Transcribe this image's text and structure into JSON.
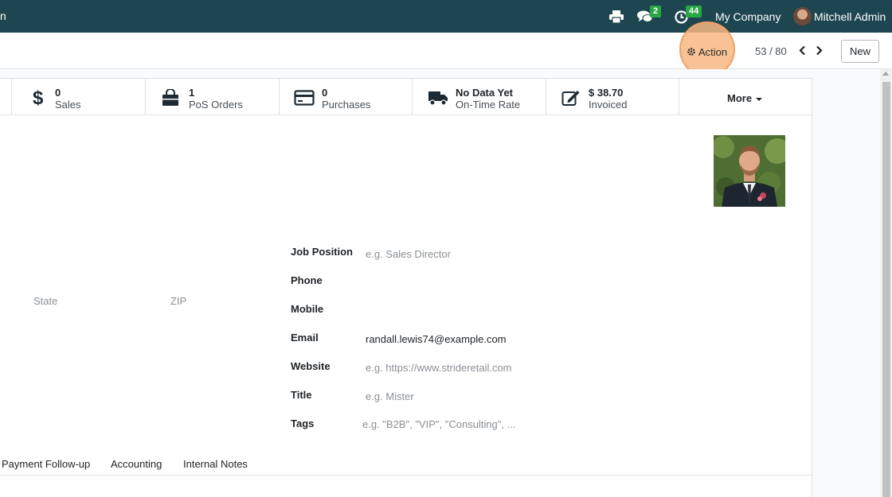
{
  "navbar": {
    "left_fragment": "n",
    "print_icon": "print-icon",
    "chat_icon": "chat-icon",
    "chat_count": "2",
    "activity_icon": "clock-icon",
    "activity_count": "44",
    "company": "My Company",
    "user": "Mitchell Admin",
    "color": "#1e4650"
  },
  "control_panel": {
    "action_label": "Action",
    "pager": "53 / 80",
    "new_label": "New",
    "highlight_color": "#f7b782"
  },
  "smart_buttons": [
    {
      "icon": "dollar-icon",
      "value": "0",
      "label": "Sales"
    },
    {
      "icon": "shopping-bag-icon",
      "value": "1",
      "label": "PoS Orders"
    },
    {
      "icon": "credit-card-icon",
      "value": "0",
      "label": "Purchases"
    },
    {
      "icon": "truck-icon",
      "value": "No Data Yet",
      "label": "On-Time Rate"
    },
    {
      "icon": "edit-icon",
      "value": "$ 38.70",
      "label": "Invoiced"
    }
  ],
  "smart_more": "More",
  "address": {
    "state_placeholder": "State",
    "zip_placeholder": "ZIP"
  },
  "fields": {
    "job_position": {
      "label": "Job Position",
      "placeholder": "e.g. Sales Director"
    },
    "phone": {
      "label": "Phone"
    },
    "mobile": {
      "label": "Mobile"
    },
    "email": {
      "label": "Email",
      "value": "randall.lewis74@example.com"
    },
    "website": {
      "label": "Website",
      "placeholder": "e.g. https://www.strideretail.com"
    },
    "title": {
      "label": "Title",
      "placeholder": "e.g. Mister"
    },
    "tags": {
      "label": "Tags",
      "placeholder": "e.g. \"B2B\", \"VIP\", \"Consulting\", ..."
    }
  },
  "tabs": [
    "Payment Follow-up",
    "Accounting",
    "Internal Notes"
  ]
}
